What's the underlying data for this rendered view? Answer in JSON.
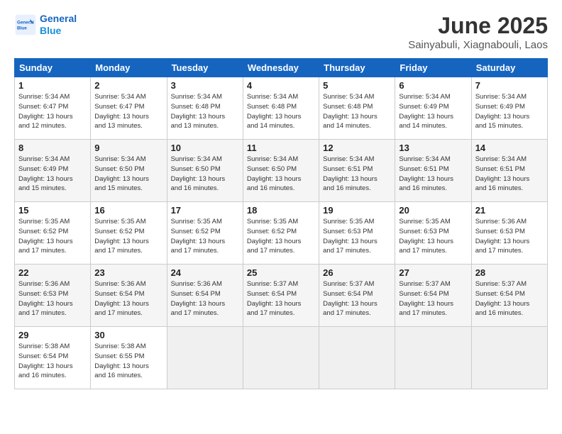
{
  "header": {
    "logo_line1": "General",
    "logo_line2": "Blue",
    "month": "June 2025",
    "location": "Sainyabuli, Xiagnabouli, Laos"
  },
  "weekdays": [
    "Sunday",
    "Monday",
    "Tuesday",
    "Wednesday",
    "Thursday",
    "Friday",
    "Saturday"
  ],
  "weeks": [
    [
      {
        "day": "1",
        "info": "Sunrise: 5:34 AM\nSunset: 6:47 PM\nDaylight: 13 hours\nand 12 minutes."
      },
      {
        "day": "2",
        "info": "Sunrise: 5:34 AM\nSunset: 6:47 PM\nDaylight: 13 hours\nand 13 minutes."
      },
      {
        "day": "3",
        "info": "Sunrise: 5:34 AM\nSunset: 6:48 PM\nDaylight: 13 hours\nand 13 minutes."
      },
      {
        "day": "4",
        "info": "Sunrise: 5:34 AM\nSunset: 6:48 PM\nDaylight: 13 hours\nand 14 minutes."
      },
      {
        "day": "5",
        "info": "Sunrise: 5:34 AM\nSunset: 6:48 PM\nDaylight: 13 hours\nand 14 minutes."
      },
      {
        "day": "6",
        "info": "Sunrise: 5:34 AM\nSunset: 6:49 PM\nDaylight: 13 hours\nand 14 minutes."
      },
      {
        "day": "7",
        "info": "Sunrise: 5:34 AM\nSunset: 6:49 PM\nDaylight: 13 hours\nand 15 minutes."
      }
    ],
    [
      {
        "day": "8",
        "info": "Sunrise: 5:34 AM\nSunset: 6:49 PM\nDaylight: 13 hours\nand 15 minutes."
      },
      {
        "day": "9",
        "info": "Sunrise: 5:34 AM\nSunset: 6:50 PM\nDaylight: 13 hours\nand 15 minutes."
      },
      {
        "day": "10",
        "info": "Sunrise: 5:34 AM\nSunset: 6:50 PM\nDaylight: 13 hours\nand 16 minutes."
      },
      {
        "day": "11",
        "info": "Sunrise: 5:34 AM\nSunset: 6:50 PM\nDaylight: 13 hours\nand 16 minutes."
      },
      {
        "day": "12",
        "info": "Sunrise: 5:34 AM\nSunset: 6:51 PM\nDaylight: 13 hours\nand 16 minutes."
      },
      {
        "day": "13",
        "info": "Sunrise: 5:34 AM\nSunset: 6:51 PM\nDaylight: 13 hours\nand 16 minutes."
      },
      {
        "day": "14",
        "info": "Sunrise: 5:34 AM\nSunset: 6:51 PM\nDaylight: 13 hours\nand 16 minutes."
      }
    ],
    [
      {
        "day": "15",
        "info": "Sunrise: 5:35 AM\nSunset: 6:52 PM\nDaylight: 13 hours\nand 17 minutes."
      },
      {
        "day": "16",
        "info": "Sunrise: 5:35 AM\nSunset: 6:52 PM\nDaylight: 13 hours\nand 17 minutes."
      },
      {
        "day": "17",
        "info": "Sunrise: 5:35 AM\nSunset: 6:52 PM\nDaylight: 13 hours\nand 17 minutes."
      },
      {
        "day": "18",
        "info": "Sunrise: 5:35 AM\nSunset: 6:52 PM\nDaylight: 13 hours\nand 17 minutes."
      },
      {
        "day": "19",
        "info": "Sunrise: 5:35 AM\nSunset: 6:53 PM\nDaylight: 13 hours\nand 17 minutes."
      },
      {
        "day": "20",
        "info": "Sunrise: 5:35 AM\nSunset: 6:53 PM\nDaylight: 13 hours\nand 17 minutes."
      },
      {
        "day": "21",
        "info": "Sunrise: 5:36 AM\nSunset: 6:53 PM\nDaylight: 13 hours\nand 17 minutes."
      }
    ],
    [
      {
        "day": "22",
        "info": "Sunrise: 5:36 AM\nSunset: 6:53 PM\nDaylight: 13 hours\nand 17 minutes."
      },
      {
        "day": "23",
        "info": "Sunrise: 5:36 AM\nSunset: 6:54 PM\nDaylight: 13 hours\nand 17 minutes."
      },
      {
        "day": "24",
        "info": "Sunrise: 5:36 AM\nSunset: 6:54 PM\nDaylight: 13 hours\nand 17 minutes."
      },
      {
        "day": "25",
        "info": "Sunrise: 5:37 AM\nSunset: 6:54 PM\nDaylight: 13 hours\nand 17 minutes."
      },
      {
        "day": "26",
        "info": "Sunrise: 5:37 AM\nSunset: 6:54 PM\nDaylight: 13 hours\nand 17 minutes."
      },
      {
        "day": "27",
        "info": "Sunrise: 5:37 AM\nSunset: 6:54 PM\nDaylight: 13 hours\nand 17 minutes."
      },
      {
        "day": "28",
        "info": "Sunrise: 5:37 AM\nSunset: 6:54 PM\nDaylight: 13 hours\nand 16 minutes."
      }
    ],
    [
      {
        "day": "29",
        "info": "Sunrise: 5:38 AM\nSunset: 6:54 PM\nDaylight: 13 hours\nand 16 minutes."
      },
      {
        "day": "30",
        "info": "Sunrise: 5:38 AM\nSunset: 6:55 PM\nDaylight: 13 hours\nand 16 minutes."
      },
      {
        "day": "",
        "info": ""
      },
      {
        "day": "",
        "info": ""
      },
      {
        "day": "",
        "info": ""
      },
      {
        "day": "",
        "info": ""
      },
      {
        "day": "",
        "info": ""
      }
    ]
  ]
}
